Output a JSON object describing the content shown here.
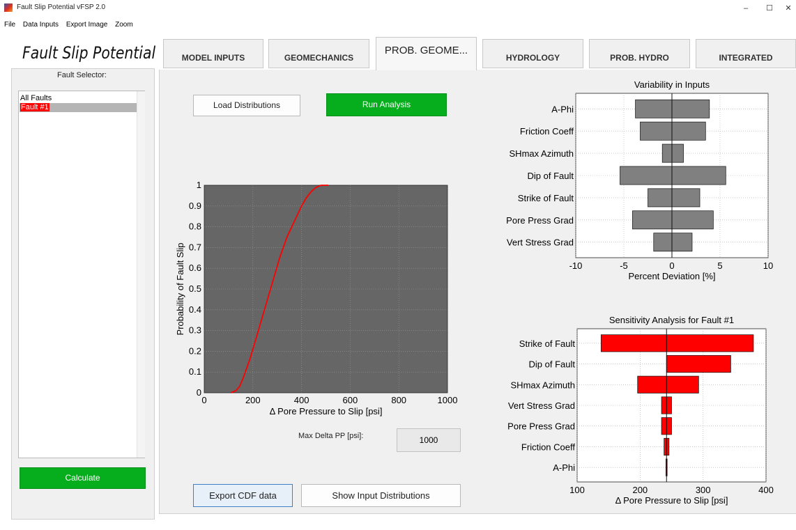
{
  "window": {
    "title": "Fault Slip Potential vFSP 2.0",
    "minimize": "–",
    "maximize": "☐",
    "close": "✕"
  },
  "menu": [
    "File",
    "Data Inputs",
    "Export Image",
    "Zoom"
  ],
  "app_title": "Fault Slip Potential",
  "tabs": [
    {
      "label": "MODEL INPUTS",
      "active": false
    },
    {
      "label": "GEOMECHANICS",
      "active": false
    },
    {
      "label": "PROB. GEOME...",
      "active": true
    },
    {
      "label": "HYDROLOGY",
      "active": false
    },
    {
      "label": "PROB. HYDRO",
      "active": false
    },
    {
      "label": "INTEGRATED",
      "active": false
    }
  ],
  "sidebar": {
    "label": "Fault Selector:",
    "items": [
      "All Faults",
      "Fault #1"
    ],
    "selected_index": 1,
    "calculate": "Calculate"
  },
  "buttons": {
    "load_distributions": "Load Distributions",
    "run_analysis": "Run Analysis",
    "export_cdf": "Export CDF data",
    "show_inputs": "Show Input Distributions"
  },
  "max_delta": {
    "label": "Max Delta PP [psi]:",
    "value": "1000"
  },
  "colors": {
    "accent_green": "#06ad1c",
    "curve_red": "#ff0000",
    "plot_bg": "#666666",
    "bar_gray": "#808080",
    "bar_red": "#ff0000",
    "selected_item_bg": "#ff0000"
  },
  "chart_data": [
    {
      "type": "line",
      "title": "",
      "xlabel": "Δ Pore Pressure to Slip [psi]",
      "ylabel": "Probability of Fault Slip",
      "xlim": [
        0,
        1000
      ],
      "ylim": [
        0,
        1
      ],
      "xticks": [
        0,
        200,
        400,
        600,
        800,
        1000
      ],
      "yticks": [
        0,
        0.1,
        0.2,
        0.3,
        0.4,
        0.5,
        0.6,
        0.7,
        0.8,
        0.9,
        1
      ],
      "grid": true,
      "series": [
        {
          "x": [
            110,
            130,
            145,
            160,
            175,
            190,
            205,
            220,
            235,
            250,
            265,
            280,
            295,
            310,
            325,
            340,
            360,
            380,
            400,
            420,
            440,
            460,
            480,
            510
          ],
          "y": [
            0,
            0.01,
            0.03,
            0.07,
            0.12,
            0.17,
            0.23,
            0.29,
            0.35,
            0.41,
            0.47,
            0.53,
            0.59,
            0.65,
            0.7,
            0.75,
            0.8,
            0.85,
            0.9,
            0.94,
            0.97,
            0.99,
            1.0,
            1.0
          ]
        }
      ]
    },
    {
      "type": "bar",
      "title": "Variability in Inputs",
      "xlabel": "Percent Deviation [%]",
      "ylabel": "",
      "xlim": [
        -10,
        10
      ],
      "xticks": [
        -10,
        -5,
        0,
        5,
        10
      ],
      "grid": true,
      "categories": [
        "A-Phi",
        "Friction Coeff",
        "SHmax Azimuth",
        "Dip of Fault",
        "Strike of Fault",
        "Pore Press Grad",
        "Vert Stress Grad"
      ],
      "low": [
        -3.8,
        -3.3,
        -1.0,
        -5.4,
        -2.5,
        -4.1,
        -1.9
      ],
      "high": [
        3.9,
        3.5,
        1.2,
        5.6,
        2.9,
        4.3,
        2.1
      ]
    },
    {
      "type": "bar",
      "title": "Sensitivity Analysis for Fault #1",
      "xlabel": "Δ Pore Pressure to Slip [psi]",
      "ylabel": "",
      "xlim": [
        100,
        400
      ],
      "xticks": [
        100,
        200,
        300,
        400
      ],
      "baseline": 242,
      "grid": true,
      "categories": [
        "Strike of Fault",
        "Dip of Fault",
        "SHmax Azimuth",
        "Vert Stress Grad",
        "Pore Press Grad",
        "Friction Coeff",
        "A-Phi"
      ],
      "low": [
        138,
        242,
        196,
        234,
        234,
        238,
        241
      ],
      "high": [
        380,
        344,
        293,
        250,
        250,
        246,
        243
      ]
    }
  ]
}
